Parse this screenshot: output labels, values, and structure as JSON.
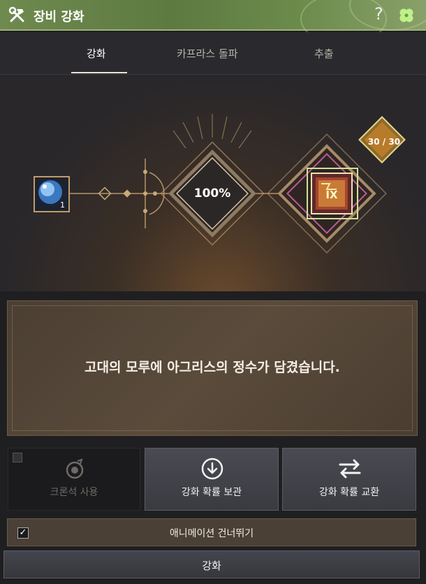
{
  "window": {
    "title": "장비 강화",
    "help_icon": "question-icon",
    "clover_icon": "clover-icon",
    "title_icon": "hammer-wrench-icon"
  },
  "tabs": [
    {
      "label": "강화",
      "active": true
    },
    {
      "label": "카프라스 돌파",
      "active": false
    },
    {
      "label": "추출",
      "active": false
    }
  ],
  "stage": {
    "success_rate": "100%",
    "material_icon": "crystal-orb-icon",
    "material_count": "1",
    "target_icon": "anvil-ix-icon",
    "target_grade": "IX",
    "essence_count": "30 / 30"
  },
  "message": "고대의 모루에 아그리스의 정수가 담겼습니다.",
  "options": {
    "chronos_label": "크론석 사용",
    "chronos_checked": false,
    "store_label": "강화 확률 보관",
    "exchange_label": "강화 확률 교환"
  },
  "skip_animation": {
    "label": "애니메이션 건너뛰기",
    "checked": true,
    "check_mark": "✓"
  },
  "enhance_button": "강화",
  "colors": {
    "title_bar": "#5d7a41",
    "accent_gold": "#d9b57a",
    "panel_brown": "#4b4036"
  }
}
